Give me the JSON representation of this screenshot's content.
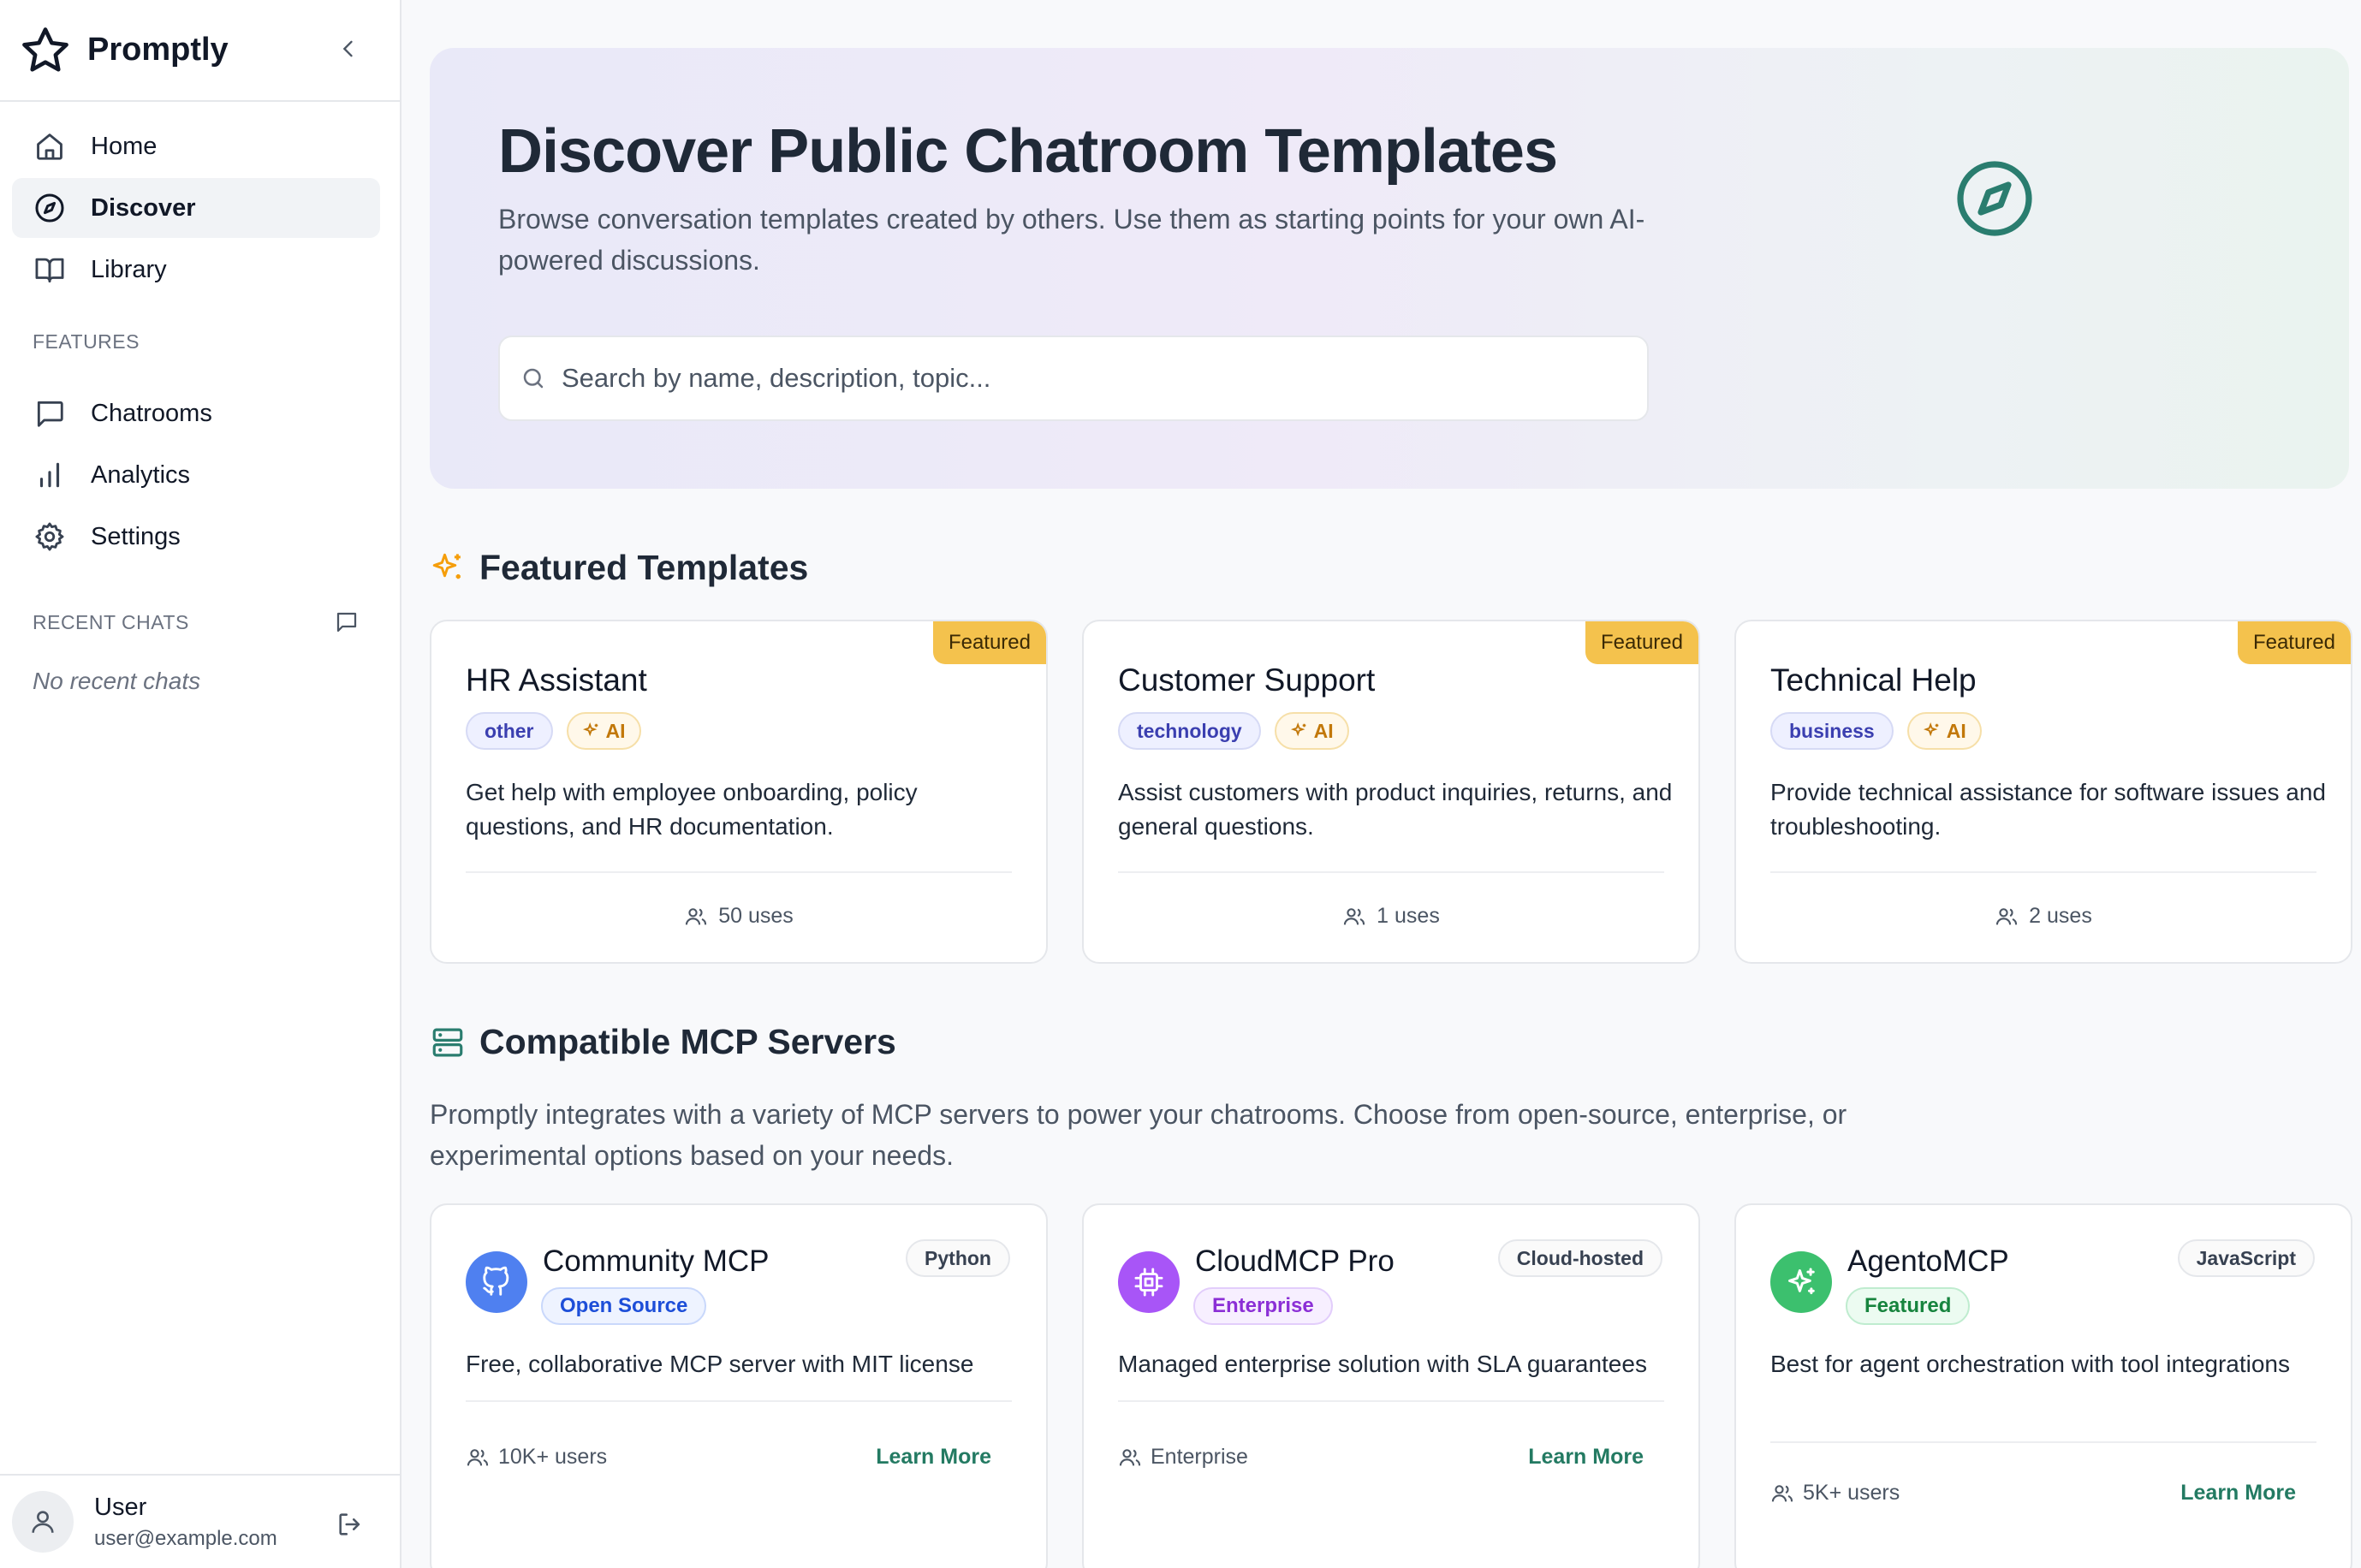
{
  "app": {
    "name": "Promptly"
  },
  "sidebar": {
    "nav": [
      {
        "label": "Home",
        "icon": "home-icon"
      },
      {
        "label": "Discover",
        "icon": "compass-icon",
        "active": true
      },
      {
        "label": "Library",
        "icon": "book-icon"
      }
    ],
    "features_label": "FEATURES",
    "features": [
      {
        "label": "Chatrooms",
        "icon": "chat-icon"
      },
      {
        "label": "Analytics",
        "icon": "bar-chart-icon"
      },
      {
        "label": "Settings",
        "icon": "gear-icon"
      }
    ],
    "recent_label": "RECENT CHATS",
    "no_recent": "No recent chats",
    "user": {
      "name": "User",
      "email": "user@example.com"
    }
  },
  "hero": {
    "title": "Discover Public Chatroom Templates",
    "description": "Browse conversation templates created by others. Use them as starting points for your own AI-powered discussions.",
    "search_placeholder": "Search by name, description, topic...",
    "search_value": ""
  },
  "featured": {
    "title": "Featured Templates",
    "badge": "Featured",
    "ai_label": "AI",
    "cards": [
      {
        "title": "HR Assistant",
        "category": "other",
        "description": "Get help with employee onboarding, policy questions, and HR documentation.",
        "uses": "50 uses"
      },
      {
        "title": "Customer Support",
        "category": "technology",
        "description": "Assist customers with product inquiries, returns, and general questions.",
        "uses": "1 uses"
      },
      {
        "title": "Technical Help",
        "category": "business",
        "description": "Provide technical assistance for software issues and troubleshooting.",
        "uses": "2 uses"
      }
    ]
  },
  "mcp": {
    "title": "Compatible MCP Servers",
    "description": "Promptly integrates with a variety of MCP servers to power your chatrooms. Choose from open-source, enterprise, or experimental options based on your needs.",
    "learn_more": "Learn More",
    "cards": [
      {
        "name": "Community MCP",
        "badge": "Open Source",
        "lang": "Python",
        "description": "Free, collaborative MCP server with MIT license",
        "users": "10K+ users",
        "color": "#4f80f0",
        "icon": "github-icon"
      },
      {
        "name": "CloudMCP Pro",
        "badge": "Enterprise",
        "lang": "Cloud-hosted",
        "description": "Managed enterprise solution with SLA guarantees",
        "users": "Enterprise",
        "color": "#a855f7",
        "icon": "chip-icon"
      },
      {
        "name": "AgentoMCP",
        "badge": "Featured",
        "lang": "JavaScript",
        "description": "Best for agent orchestration with tool integrations",
        "users": "5K+ users",
        "color": "#3cc06e",
        "icon": "sparkle-icon"
      }
    ]
  },
  "colors": {
    "accent": "#2a7d6f",
    "featured_tag": "#f4c24d",
    "learn_more": "#237a62"
  }
}
